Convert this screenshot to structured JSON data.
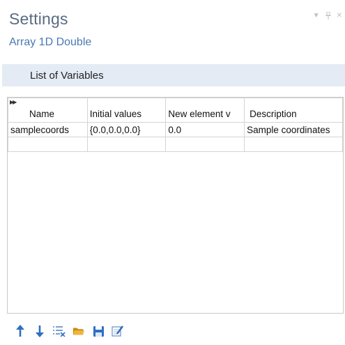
{
  "panel": {
    "title": "Settings",
    "subtitle": "Array 1D Double"
  },
  "window_controls": {
    "menu_icon": "dropdown-arrow-icon",
    "pin_icon": "pin-icon",
    "close_icon": "close-icon"
  },
  "section": {
    "label": "List of Variables"
  },
  "table": {
    "columns": [
      "Name",
      "Initial values",
      "New element v",
      "Description"
    ],
    "rows": [
      [
        "samplecoords",
        "{0.0,0.0,0.0}",
        "0.0",
        "Sample coordinates"
      ],
      [
        "",
        "",
        "",
        ""
      ]
    ]
  },
  "toolbar": {
    "buttons": [
      {
        "name": "move-up-icon"
      },
      {
        "name": "move-down-icon"
      },
      {
        "name": "clear-table-icon"
      },
      {
        "name": "open-folder-icon"
      },
      {
        "name": "save-icon"
      },
      {
        "name": "edit-icon"
      }
    ]
  },
  "colors": {
    "title": "#5a6b80",
    "subtitle": "#4a79b0",
    "section_bar": "#e4ebf4",
    "accent_blue": "#2f6fc0",
    "folder": "#e0a21f"
  }
}
